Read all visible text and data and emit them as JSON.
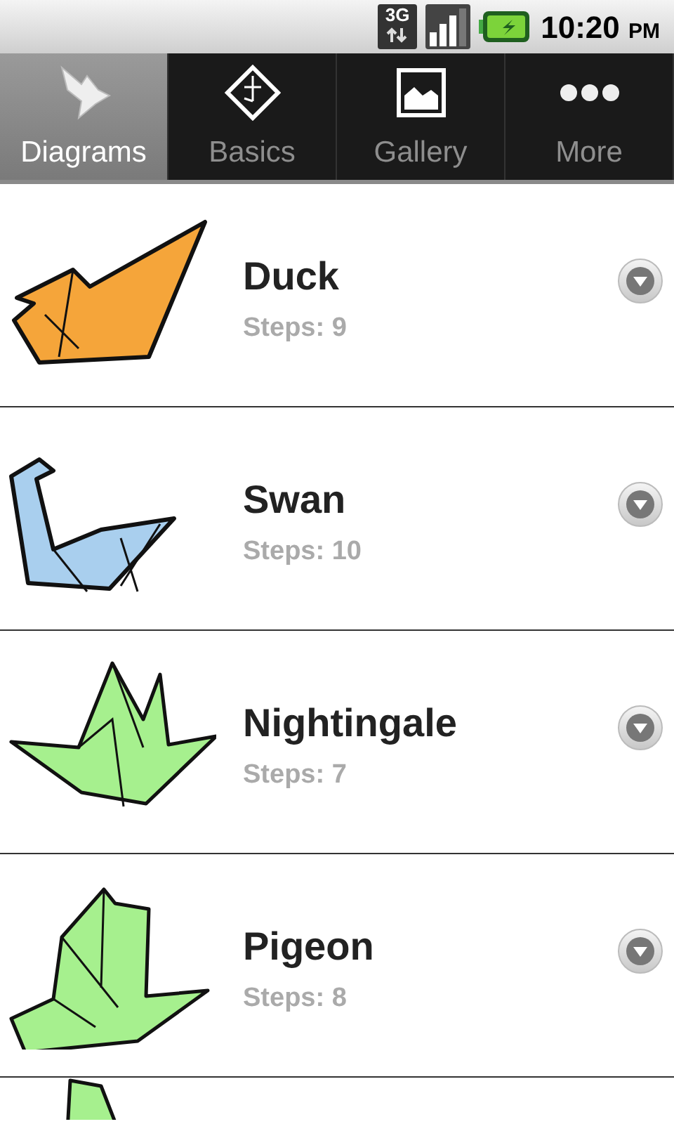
{
  "status_bar": {
    "network": "3G",
    "time": "10:20",
    "ampm": "PM"
  },
  "tabs": [
    {
      "label": "Diagrams",
      "selected": true
    },
    {
      "label": "Basics",
      "selected": false
    },
    {
      "label": "Gallery",
      "selected": false
    },
    {
      "label": "More",
      "selected": false
    }
  ],
  "items": [
    {
      "name": "Duck",
      "steps": "Steps: 9",
      "color": "#f5a53a"
    },
    {
      "name": "Swan",
      "steps": "Steps: 10",
      "color": "#a9cfee"
    },
    {
      "name": "Nightingale",
      "steps": "Steps: 7",
      "color": "#a6f08e"
    },
    {
      "name": "Pigeon",
      "steps": "Steps: 8",
      "color": "#a6f08e"
    },
    {
      "color": "#a6f08e"
    }
  ]
}
